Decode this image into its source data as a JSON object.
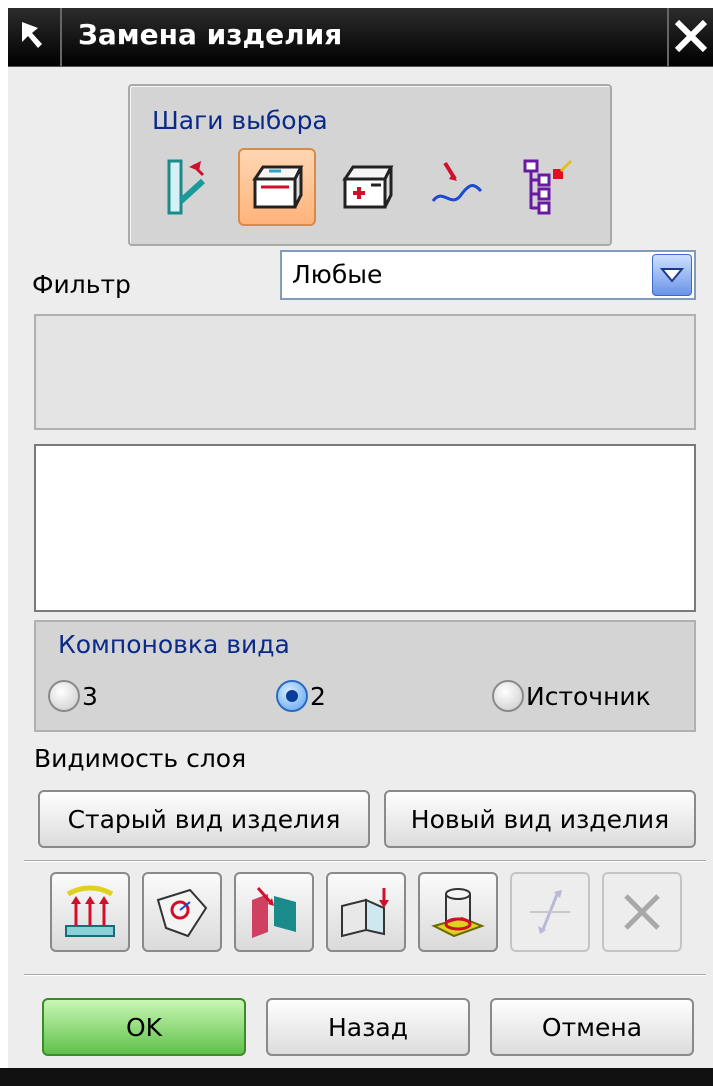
{
  "window": {
    "title": "Замена изделия"
  },
  "steps": {
    "label": "Шаги выбора",
    "icons": [
      "select-step-1-icon",
      "select-step-2-icon",
      "select-step-3-icon",
      "select-step-4-icon",
      "select-step-5-icon"
    ],
    "active_index": 1
  },
  "filter": {
    "label": "Фильтр",
    "value": "Любые"
  },
  "layout": {
    "label": "Компоновка вида",
    "options": [
      "3",
      "2",
      "Источник"
    ],
    "selected": "2"
  },
  "visibility": {
    "label": "Видимость слоя",
    "old_view": "Старый вид изделия",
    "new_view": "Новый вид изделия"
  },
  "tools": [
    "align-vectors-icon",
    "surface-point-icon",
    "move-faces-icon",
    "fold-arrow-icon",
    "cylinder-plane-icon",
    "swap-arrows-icon",
    "delete-icon"
  ],
  "buttons": {
    "ok": "OK",
    "back": "Назад",
    "cancel": "Отмена"
  },
  "colors": {
    "accent_blue": "#0a2a8a",
    "ok_green": "#5fc04a",
    "active_step": "#ffb37a"
  }
}
